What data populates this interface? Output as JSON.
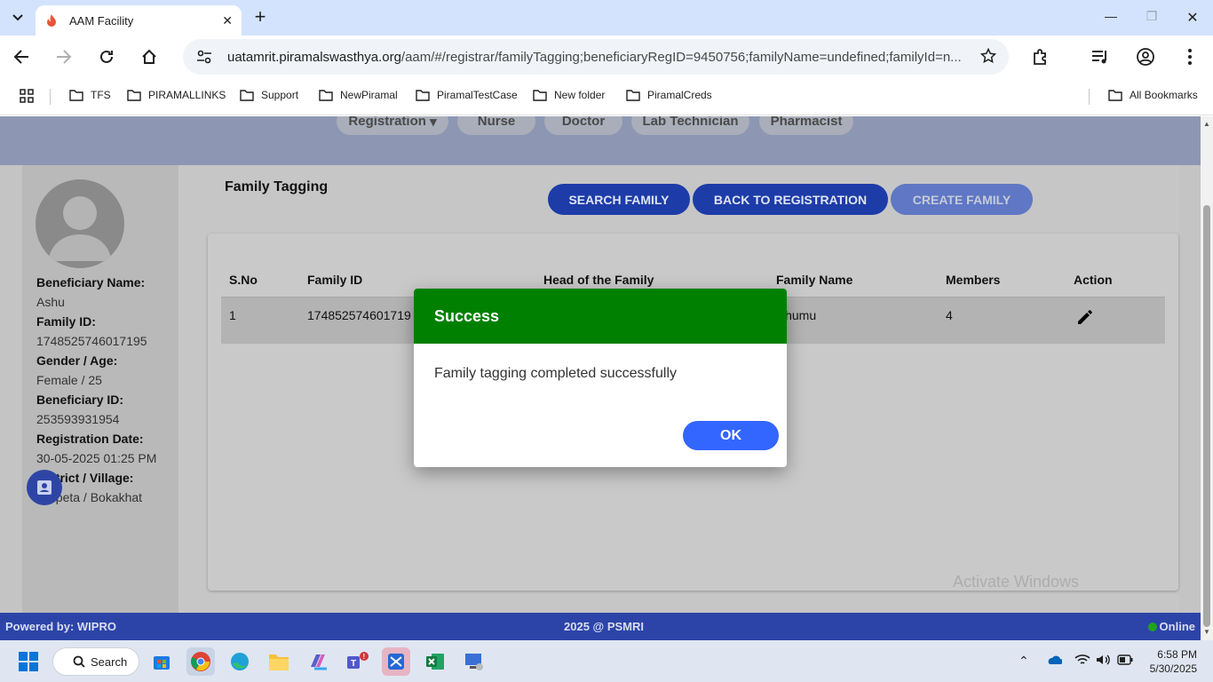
{
  "browser": {
    "tab_title": "AAM Facility",
    "url_host": "uatamrit.piramalswasthya.org",
    "url_path": "/aam/#/registrar/familyTagging;beneficiaryRegID=9450756;familyName=undefined;familyId=n...",
    "bookmarks": [
      "TFS",
      "PIRAMALLINKS",
      "Support",
      "NewPiramal",
      "PiramalTestCase",
      "New folder",
      "PiramalCreds"
    ],
    "all_bookmarks": "All Bookmarks"
  },
  "roles": [
    "Registration",
    "Nurse",
    "Doctor",
    "Lab Technician",
    "Pharmacist"
  ],
  "beneficiary": {
    "name_label": "Beneficiary Name:",
    "name": "Ashu",
    "family_id_label": "Family ID:",
    "family_id": "1748525746017195",
    "gender_age_label": "Gender / Age:",
    "gender_age": "Female / 25",
    "ben_id_label": "Beneficiary ID:",
    "ben_id": "253593931954",
    "reg_date_label": "Registration Date:",
    "reg_date": "30-05-2025 01:25 PM",
    "district_label": "District / Village:",
    "district": "Barpeta / Bokakhat"
  },
  "main": {
    "title": "Family Tagging",
    "search_btn": "SEARCH FAMILY",
    "back_btn": "BACK TO REGISTRATION",
    "create_btn": "CREATE FAMILY"
  },
  "table": {
    "headers": [
      "S.No",
      "Family ID",
      "Head of the Family",
      "Family Name",
      "Members",
      "Action"
    ],
    "rows": [
      {
        "sno": "1",
        "family_id": "174852574601719",
        "head": "",
        "family_name": "Chumu",
        "members": "4"
      }
    ]
  },
  "modal": {
    "title": "Success",
    "message": "Family tagging completed successfully",
    "ok": "OK"
  },
  "footer": {
    "powered": "Powered by: WIPRO",
    "copyright": "2025 @ PSMRI",
    "status": "Online"
  },
  "watermark": "Activate Windows",
  "taskbar": {
    "search": "Search",
    "time": "6:58 PM",
    "date": "5/30/2025"
  }
}
